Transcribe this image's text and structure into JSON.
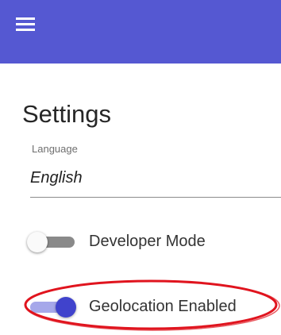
{
  "colors": {
    "app_bar": "#5558d2",
    "switch_on_thumb": "#4043cc",
    "switch_on_track": "#a6a8ea",
    "switch_off_track": "#8a8a8a",
    "annotation": "#e0141e"
  },
  "header": {
    "menu_icon": "hamburger-menu-icon"
  },
  "page": {
    "title": "Settings"
  },
  "language": {
    "label": "Language",
    "value": "English"
  },
  "settings": {
    "developer_mode": {
      "label": "Developer Mode",
      "enabled": false
    },
    "geolocation": {
      "label": "Geolocation Enabled",
      "enabled": true
    }
  }
}
